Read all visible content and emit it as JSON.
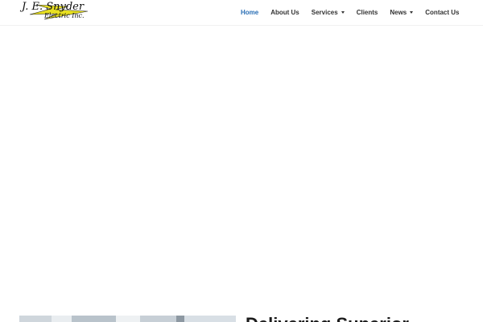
{
  "logo": {
    "line1": "J. E. Snyder",
    "line2": "Electric Inc.",
    "accent_color": "#e8e021"
  },
  "nav": {
    "items": [
      {
        "label": "Home",
        "active": true,
        "has_dropdown": false
      },
      {
        "label": "About Us",
        "active": false,
        "has_dropdown": false
      },
      {
        "label": "Services",
        "active": false,
        "has_dropdown": true
      },
      {
        "label": "Clients",
        "active": false,
        "has_dropdown": false
      },
      {
        "label": "News",
        "active": false,
        "has_dropdown": true
      },
      {
        "label": "Contact Us",
        "active": false,
        "has_dropdown": false
      }
    ],
    "active_color": "#2a6fb5",
    "text_color": "#333333"
  },
  "section": {
    "heading": "Delivering Superior"
  }
}
